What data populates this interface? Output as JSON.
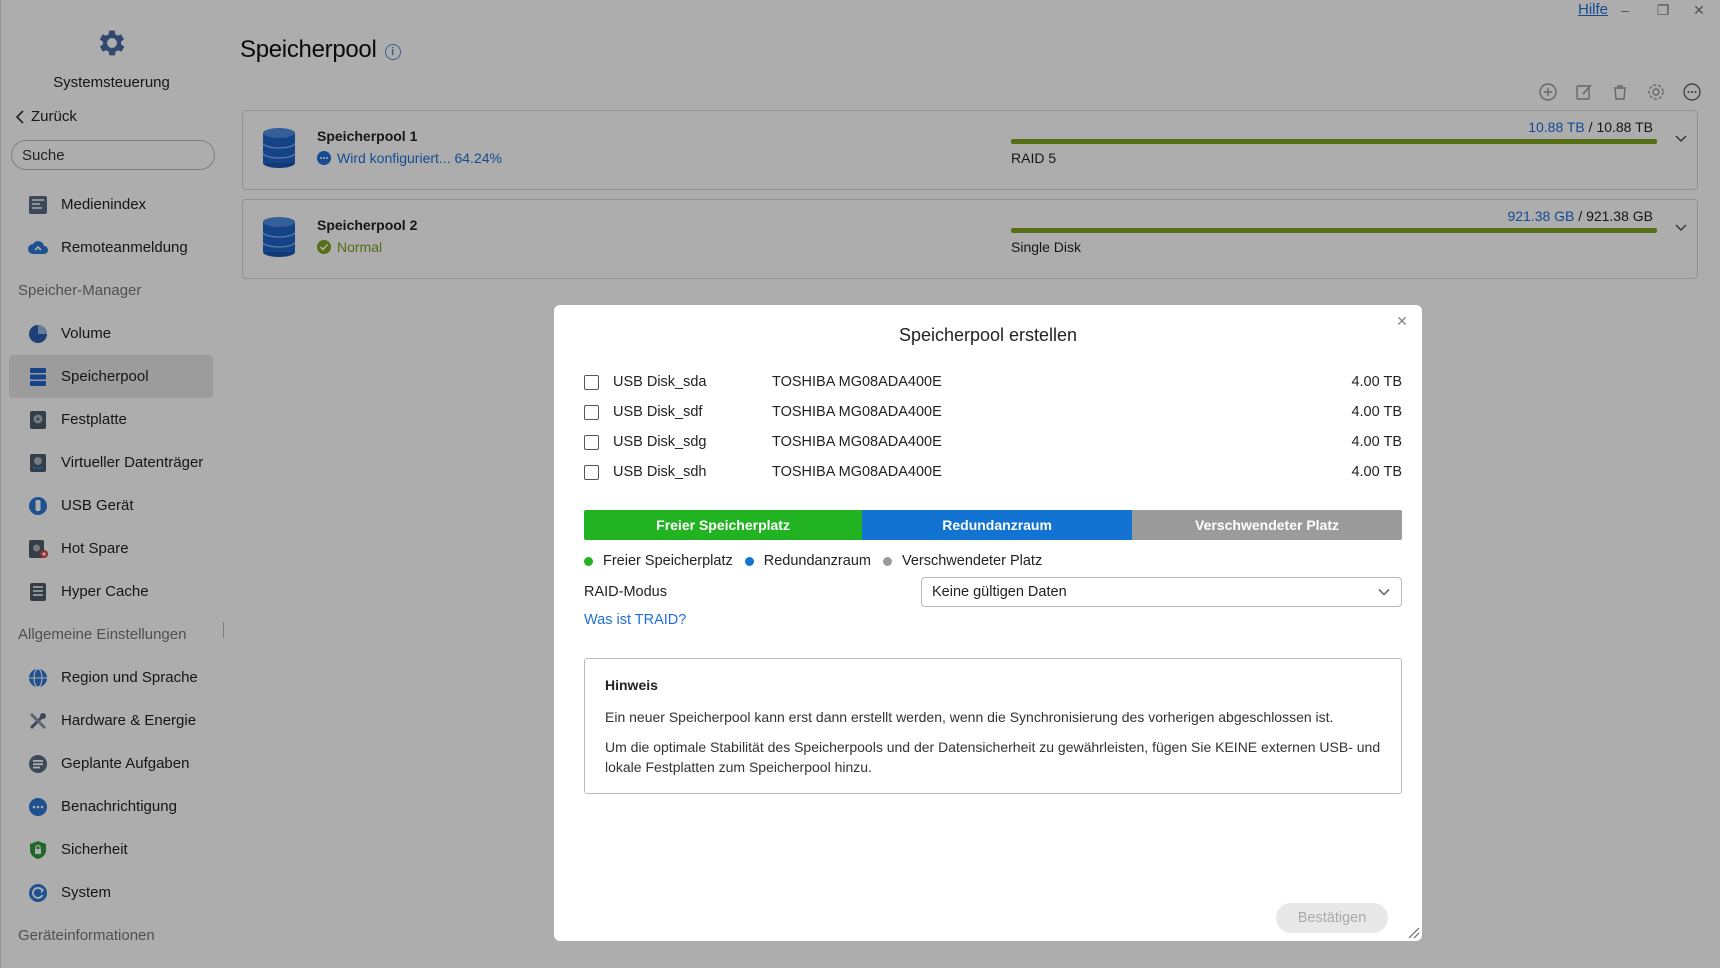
{
  "window": {
    "help_label": "Hilfe",
    "minimize_glyph": "–",
    "restore_glyph": "❐",
    "close_glyph": "✕"
  },
  "sidebar": {
    "title": "Systemsteuerung",
    "back_label": "Zurück",
    "search_placeholder": "Suche",
    "items_top": [
      {
        "label": "Medienindex",
        "icon": "media-index-icon"
      },
      {
        "label": "Remoteanmeldung",
        "icon": "cloud-remote-icon"
      }
    ],
    "section_storage": "Speicher-Manager",
    "items_storage": [
      {
        "label": "Volume",
        "icon": "volume-pie-icon"
      },
      {
        "label": "Speicherpool",
        "icon": "storage-pool-icon",
        "active": true
      },
      {
        "label": "Festplatte",
        "icon": "hard-disk-icon"
      },
      {
        "label": "Virtueller Datenträger",
        "icon": "virtual-disk-icon"
      },
      {
        "label": "USB Gerät",
        "icon": "usb-device-icon"
      },
      {
        "label": "Hot Spare",
        "icon": "hot-spare-icon"
      },
      {
        "label": "Hyper Cache",
        "icon": "hyper-cache-icon"
      }
    ],
    "section_general": "Allgemeine Einstellungen",
    "items_general": [
      {
        "label": "Region und Sprache",
        "icon": "globe-icon"
      },
      {
        "label": "Hardware & Energie",
        "icon": "tools-icon"
      },
      {
        "label": "Geplante Aufgaben",
        "icon": "tasks-icon"
      },
      {
        "label": "Benachrichtigung",
        "icon": "chat-bubble-icon"
      },
      {
        "label": "Sicherheit",
        "icon": "shield-icon"
      },
      {
        "label": "System",
        "icon": "system-refresh-icon"
      }
    ],
    "section_device": "Geräteinformationen"
  },
  "main": {
    "page_title": "Speicherpool",
    "pools": [
      {
        "name": "Speicherpool 1",
        "status": "Wird konfiguriert... 64.24%",
        "status_color": "#1e6fd9",
        "used": "10.88 TB",
        "total": "10.88 TB",
        "fill_percent": 100,
        "type": "RAID 5"
      },
      {
        "name": "Speicherpool 2",
        "status": "Normal",
        "status_color": "#7fa320",
        "used": "921.38 GB",
        "total": "921.38 GB",
        "fill_percent": 100,
        "type": "Single Disk"
      }
    ]
  },
  "modal": {
    "title": "Speicherpool erstellen",
    "disks": [
      {
        "name": "USB Disk_sda",
        "model": "TOSHIBA MG08ADA400E",
        "size": "4.00 TB"
      },
      {
        "name": "USB Disk_sdf",
        "model": "TOSHIBA MG08ADA400E",
        "size": "4.00 TB"
      },
      {
        "name": "USB Disk_sdg",
        "model": "TOSHIBA MG08ADA400E",
        "size": "4.00 TB"
      },
      {
        "name": "USB Disk_sdh",
        "model": "TOSHIBA MG08ADA400E",
        "size": "4.00 TB"
      }
    ],
    "capacity_segments": [
      {
        "label": "Freier Speicherplatz",
        "color": "#22b322",
        "share": 0.34
      },
      {
        "label": "Redundanzraum",
        "color": "#1273d2",
        "share": 0.33
      },
      {
        "label": "Verschwendeter Platz",
        "color": "#9b9b9b",
        "share": 0.33
      }
    ],
    "legend": [
      {
        "label": "Freier Speicherplatz",
        "color": "#22b322"
      },
      {
        "label": "Redundanzraum",
        "color": "#1273d2"
      },
      {
        "label": "Verschwendeter Platz",
        "color": "#9b9b9b"
      }
    ],
    "raid_label": "RAID-Modus",
    "raid_value": "Keine gültigen Daten",
    "traid_link": "Was ist TRAID?",
    "hint_title": "Hinweis",
    "hint_lines": [
      "Ein neuer Speicherpool kann erst dann erstellt werden, wenn die Synchronisierung des vorherigen abgeschlossen ist.",
      "Um die optimale Stabilität des Speicherpools und der Datensicherheit zu gewährleisten, fügen Sie KEINE externen USB- und lokale Festplatten zum Speicherpool hinzu."
    ],
    "confirm_label": "Bestätigen",
    "close_glyph": "✕"
  }
}
